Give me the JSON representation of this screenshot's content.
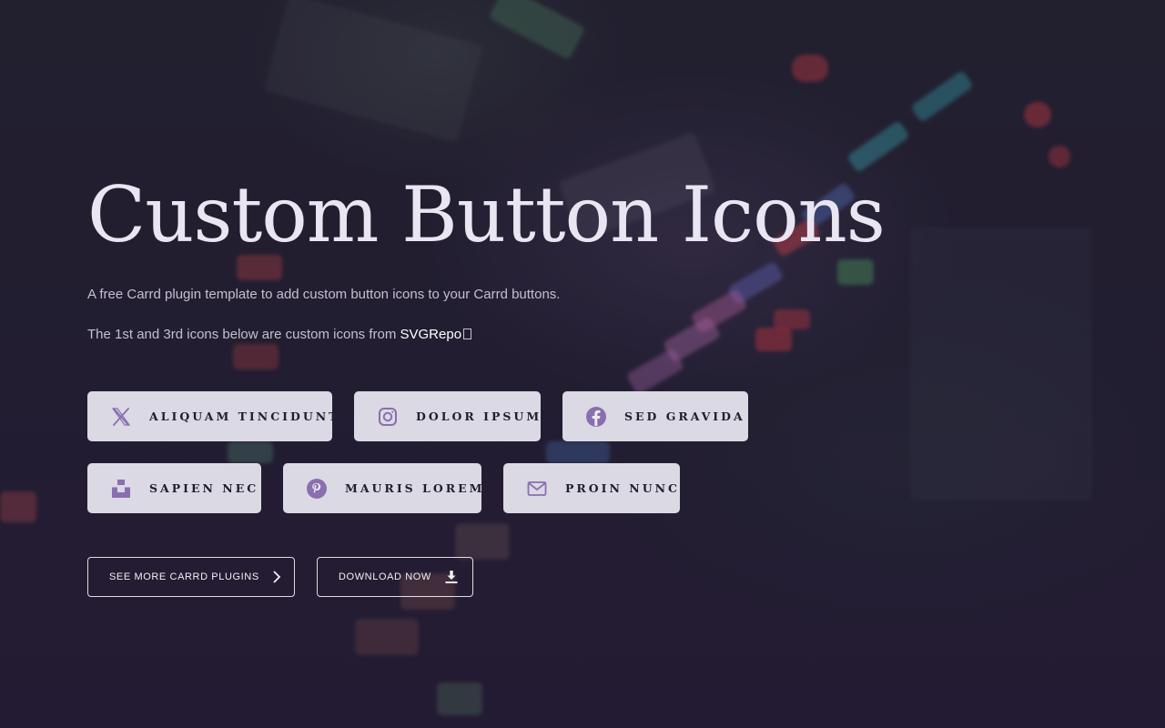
{
  "hero": {
    "title": "Custom Button Icons",
    "intro": "A free Carrd plugin template to add custom button icons to your Carrd buttons.",
    "credit_prefix": "The 1st and 3rd icons below are custom icons from ",
    "credit_link": "SVGRepo"
  },
  "buttons": [
    {
      "label": "Aliquam tincidunt",
      "icon": "x-twitter-icon"
    },
    {
      "label": "Dolor ipsum",
      "icon": "instagram-icon"
    },
    {
      "label": "Sed gravida",
      "icon": "facebook-icon"
    },
    {
      "label": "Sapien nec",
      "icon": "unsplash-icon"
    },
    {
      "label": "Mauris lorem",
      "icon": "pinterest-icon"
    },
    {
      "label": "Proin nunc",
      "icon": "envelope-icon"
    }
  ],
  "actions": [
    {
      "label": "See more Carrd plugins",
      "icon": "chevron-right-icon"
    },
    {
      "label": "Download now",
      "icon": "download-icon"
    }
  ],
  "colors": {
    "icon_accent": "#8a6fb0",
    "button_bg": "#ece9f2",
    "button_text": "#221d2e",
    "page_bg": "#231f33"
  }
}
